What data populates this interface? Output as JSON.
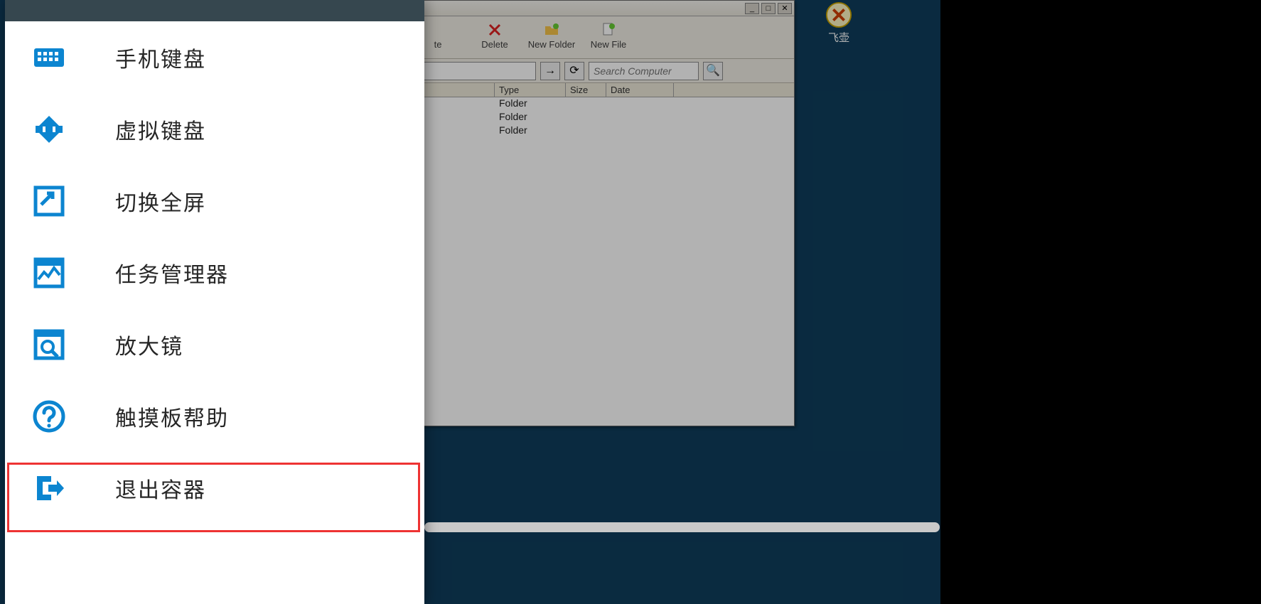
{
  "desktop": {
    "icon_label": "飞壶"
  },
  "filemanager": {
    "window_buttons": {
      "min": "_",
      "max": "□",
      "close": "✕"
    },
    "toolbar": {
      "delete": "Delete",
      "new_folder": "New Folder",
      "new_file": "New File",
      "paste_fragment": "te"
    },
    "address_value": "",
    "go_glyph": "→",
    "refresh_glyph": "⟳",
    "search_placeholder": "Search Computer",
    "search_glyph": "🔍",
    "columns": {
      "name": "",
      "type": "Type",
      "size": "Size",
      "date": "Date"
    },
    "col_widths": {
      "name": 470,
      "type": 100,
      "size": 57,
      "date": 95
    },
    "rows": [
      {
        "name": "",
        "type": "Folder",
        "size": "",
        "date": ""
      },
      {
        "name": "",
        "type": "Folder",
        "size": "",
        "date": ""
      },
      {
        "name": "",
        "type": "Folder",
        "size": "",
        "date": ""
      }
    ]
  },
  "sidemenu": {
    "items": [
      {
        "key": "phone-keyboard",
        "label": "手机键盘"
      },
      {
        "key": "virtual-keyboard",
        "label": "虚拟键盘"
      },
      {
        "key": "toggle-fullscreen",
        "label": "切换全屏"
      },
      {
        "key": "task-manager",
        "label": "任务管理器"
      },
      {
        "key": "magnifier",
        "label": "放大镜"
      },
      {
        "key": "touchpad-help",
        "label": "触摸板帮助"
      },
      {
        "key": "exit-container",
        "label": "退出容器"
      }
    ],
    "highlight_index": 6
  },
  "colors": {
    "accent": "#0c85d0",
    "desktop_bg": "#0f3d5c",
    "highlight": "#e33"
  }
}
